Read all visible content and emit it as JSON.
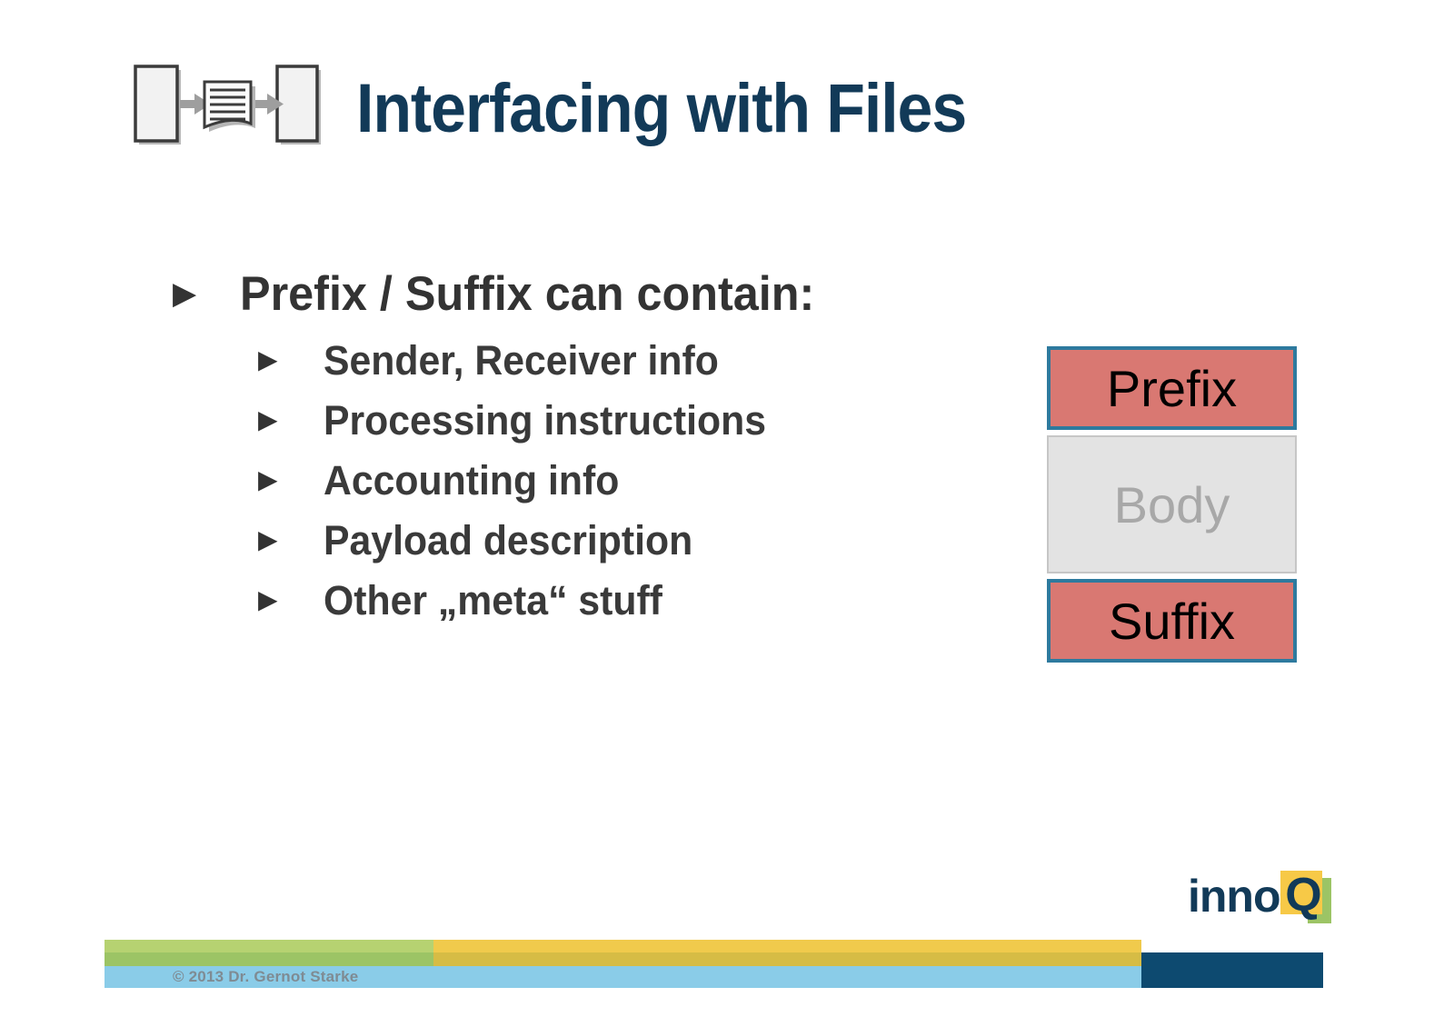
{
  "slide": {
    "title": "Interfacing with Files",
    "header_icon": "file-transfer-icon"
  },
  "content": {
    "main_bullet": {
      "marker": "▶",
      "label": "Prefix / Suffix can contain:"
    },
    "sub_bullets": [
      {
        "marker": "▶",
        "label": "Sender, Receiver info"
      },
      {
        "marker": "▶",
        "label": "Processing instructions"
      },
      {
        "marker": "▶",
        "label": "Accounting info"
      },
      {
        "marker": "▶",
        "label": "Payload description"
      },
      {
        "marker": "▶",
        "label": "Other „meta“ stuff"
      }
    ]
  },
  "diagram": {
    "name": "message-structure-diagram",
    "boxes": [
      {
        "label": "Prefix",
        "fill": "#D97872",
        "border": "#2E7A9E",
        "text_color": "#000000"
      },
      {
        "label": "Body",
        "fill": "#E3E3E3",
        "border": "#C6C6C6",
        "text_color": "#A8A8A8"
      },
      {
        "label": "Suffix",
        "fill": "#D97872",
        "border": "#2E7A9E",
        "text_color": "#000000"
      }
    ]
  },
  "footer": {
    "copyright": "© 2013 Dr. Gernot Starke",
    "bars": {
      "green": "#B6D271",
      "green_dark": "#9CC465",
      "yellow": "#F0CA4C",
      "yellow_dark": "#D6BC45",
      "navy": "#0D4A70",
      "light_blue": "#8ACCE8"
    }
  },
  "logo": {
    "name": "innoq-logo",
    "text_inno": "inno",
    "text_q": "Q",
    "navy": "#123A58",
    "yellow": "#F7C947",
    "green": "#9CC465"
  },
  "theme": {
    "title_color": "#123A58",
    "body_text_color": "#333333",
    "background": "#FFFFFF"
  }
}
